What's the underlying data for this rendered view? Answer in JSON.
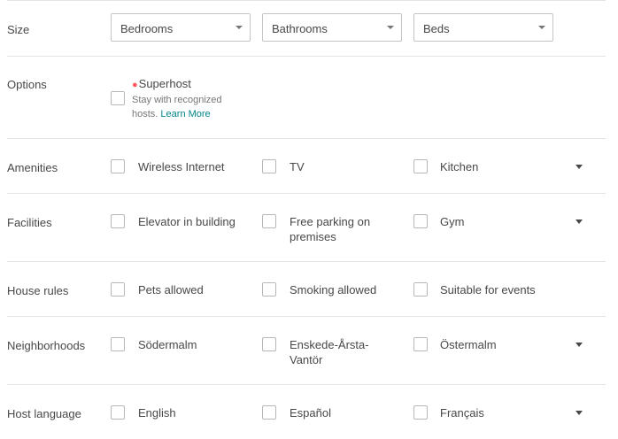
{
  "size": {
    "label": "Size",
    "bedrooms": "Bedrooms",
    "bathrooms": "Bathrooms",
    "beds": "Beds"
  },
  "options": {
    "label": "Options",
    "superhost_title": "Superhost",
    "superhost_desc": "Stay with recognized hosts.",
    "learn_more": "Learn More"
  },
  "amenities": {
    "label": "Amenities",
    "items": [
      "Wireless Internet",
      "TV",
      "Kitchen"
    ]
  },
  "facilities": {
    "label": "Facilities",
    "items": [
      "Elevator in building",
      "Free parking on premises",
      "Gym"
    ]
  },
  "house_rules": {
    "label": "House rules",
    "items": [
      "Pets allowed",
      "Smoking allowed",
      "Suitable for events"
    ]
  },
  "neighborhoods": {
    "label": "Neighborhoods",
    "items": [
      "Södermalm",
      "Enskede-Årsta-Vantör",
      "Östermalm"
    ]
  },
  "host_language": {
    "label": "Host language",
    "items": [
      "English",
      "Español",
      "Français"
    ]
  },
  "colors": {
    "accent": "#008489",
    "superhost": "#ff5a5f",
    "text": "#484848",
    "border": "#e4e4e4"
  }
}
